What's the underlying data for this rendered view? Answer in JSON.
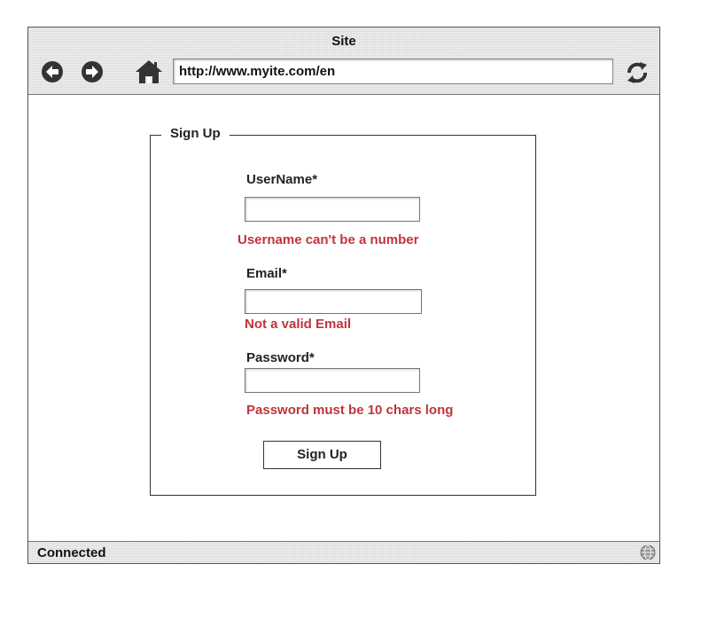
{
  "browser": {
    "title": "Site",
    "url": "http://www.myite.com/en",
    "status": "Connected",
    "icons": {
      "back": "back-arrow-icon",
      "forward": "forward-arrow-icon",
      "home": "home-icon",
      "refresh": "refresh-icon",
      "status": "globe-icon"
    }
  },
  "form": {
    "legend": "Sign Up",
    "username": {
      "label": "UserName*",
      "value": "",
      "error": "Username can't be a number"
    },
    "email": {
      "label": "Email*",
      "value": "",
      "error": "Not a valid Email"
    },
    "password": {
      "label": "Password*",
      "value": "",
      "error": "Password must be 10 chars long"
    },
    "submit_label": "Sign Up"
  },
  "colors": {
    "error": "#c0343c",
    "chrome": "#e8e8e8",
    "border": "#333333"
  }
}
